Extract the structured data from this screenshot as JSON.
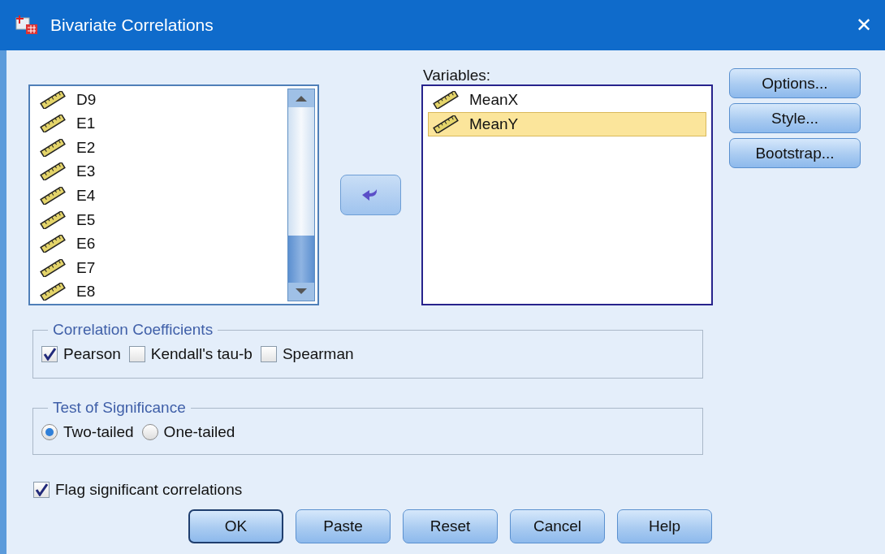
{
  "window": {
    "title": "Bivariate Correlations",
    "close": "✕"
  },
  "source_list": {
    "items": [
      {
        "name": "D9",
        "selected": false
      },
      {
        "name": "E1",
        "selected": false
      },
      {
        "name": "E2",
        "selected": false
      },
      {
        "name": "E3",
        "selected": false
      },
      {
        "name": "E4",
        "selected": false
      },
      {
        "name": "E5",
        "selected": false
      },
      {
        "name": "E6",
        "selected": false
      },
      {
        "name": "E7",
        "selected": false
      },
      {
        "name": "E8",
        "selected": false
      }
    ]
  },
  "variables": {
    "label": "Variables:",
    "items": [
      {
        "name": "MeanX",
        "selected": false
      },
      {
        "name": "MeanY",
        "selected": true
      }
    ]
  },
  "side_buttons": [
    "Options...",
    "Style...",
    "Bootstrap..."
  ],
  "correlation_coefficients": {
    "title": "Correlation Coefficients",
    "options": [
      {
        "label": "Pearson",
        "checked": true
      },
      {
        "label": "Kendall's tau-b",
        "checked": false
      },
      {
        "label": "Spearman",
        "checked": false
      }
    ]
  },
  "test_of_significance": {
    "title": "Test of Significance",
    "options": [
      {
        "label": "Two-tailed",
        "selected": true
      },
      {
        "label": "One-tailed",
        "selected": false
      }
    ]
  },
  "flag_significant": {
    "label": "Flag significant correlations",
    "checked": true
  },
  "buttons": [
    {
      "label": "OK",
      "default": true
    },
    {
      "label": "Paste",
      "default": false
    },
    {
      "label": "Reset",
      "default": false
    },
    {
      "label": "Cancel",
      "default": false
    },
    {
      "label": "Help",
      "default": false
    }
  ]
}
